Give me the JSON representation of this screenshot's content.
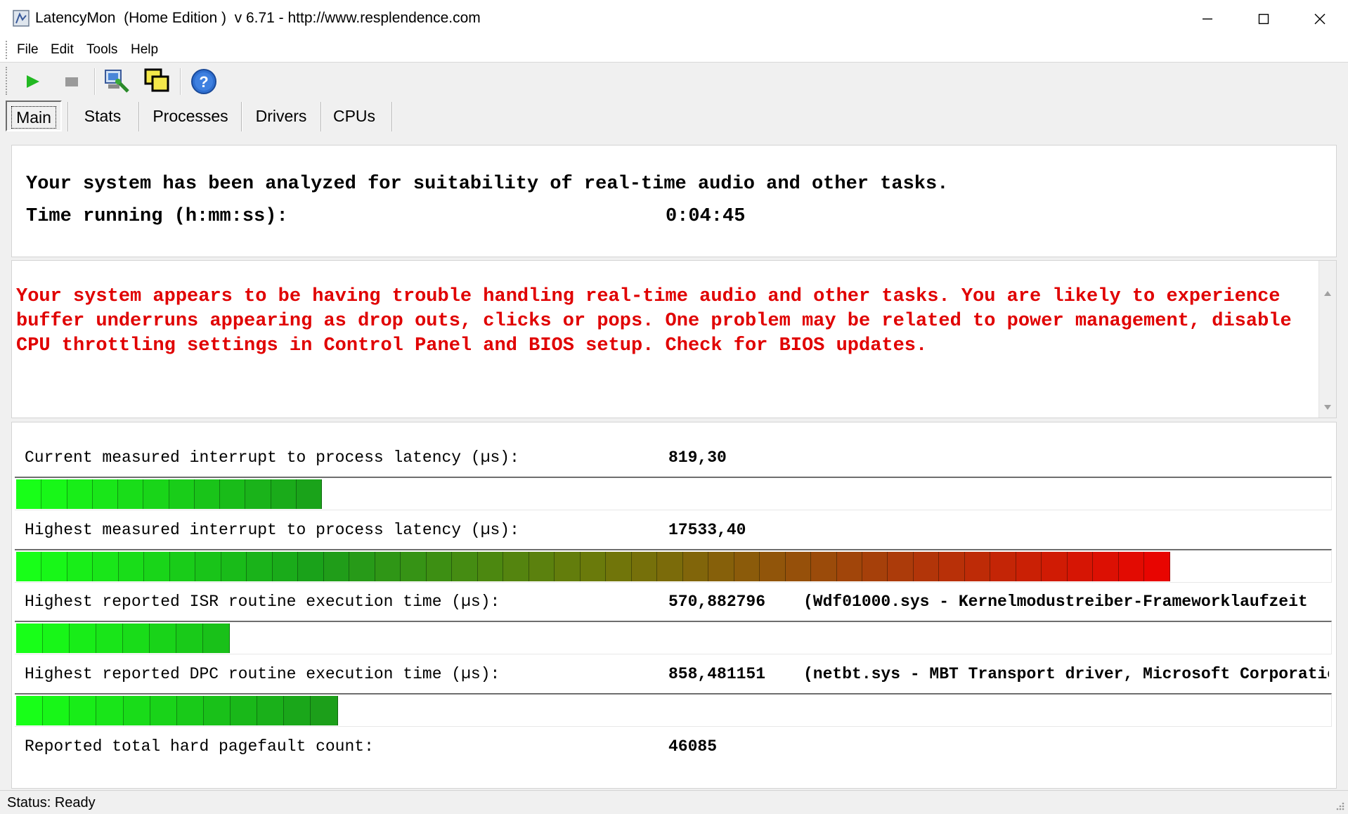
{
  "window": {
    "title": "LatencyMon  (Home Edition )  v 6.71 - http://www.resplendence.com",
    "minimize_icon": "minimize-icon",
    "maximize_icon": "maximize-icon",
    "close_icon": "close-icon"
  },
  "menu": {
    "items": [
      {
        "label": "File"
      },
      {
        "label": "Edit"
      },
      {
        "label": "Tools"
      },
      {
        "label": "Help"
      }
    ]
  },
  "toolbar": {
    "buttons": [
      {
        "icon": "play-icon"
      },
      {
        "icon": "stop-icon"
      },
      {
        "icon": "computer-settings-icon"
      },
      {
        "icon": "windows-icon"
      },
      {
        "icon": "help-icon"
      }
    ]
  },
  "tabs": [
    {
      "label": "Main",
      "active": true
    },
    {
      "label": "Stats"
    },
    {
      "label": "Processes"
    },
    {
      "label": "Drivers"
    },
    {
      "label": "CPUs"
    }
  ],
  "summary": {
    "analyzed_text": "Your system has been analyzed for suitability of real-time audio and other tasks.",
    "time_running_label": "Time running (h:mm:ss):",
    "time_running_value": "0:04:45"
  },
  "warning": {
    "text": "Your system appears to be having trouble handling real-time audio and other tasks. You are likely to experience buffer underruns appearing as drop outs, clicks or pops. One problem may be related to power management, disable CPU throttling settings in Control Panel and BIOS setup. Check for BIOS updates.",
    "color": "#e00000"
  },
  "stats": [
    {
      "label": "Current measured interrupt to process latency (µs):",
      "value": "819,30",
      "extra": "",
      "bar_fraction": 0.233,
      "bar_segments": 12
    },
    {
      "label": "Highest measured interrupt to process latency (µs):",
      "value": "17533,40",
      "extra": "",
      "bar_fraction": 0.879,
      "bar_segments": 45
    },
    {
      "label": "Highest reported ISR routine execution time (µs):",
      "value": "570,882796",
      "extra": "(Wdf01000.sys - Kernelmodustreiber-Frameworklaufzeit",
      "bar_fraction": 0.163,
      "bar_segments": 8
    },
    {
      "label": "Highest reported DPC routine execution time (µs):",
      "value": "858,481151",
      "extra": "(netbt.sys - MBT Transport driver, Microsoft Corporation",
      "bar_fraction": 0.245,
      "bar_segments": 12
    },
    {
      "label": "Reported total hard pagefault count:",
      "value": "46085",
      "extra": ""
    }
  ],
  "status": {
    "text": "Status: Ready"
  }
}
